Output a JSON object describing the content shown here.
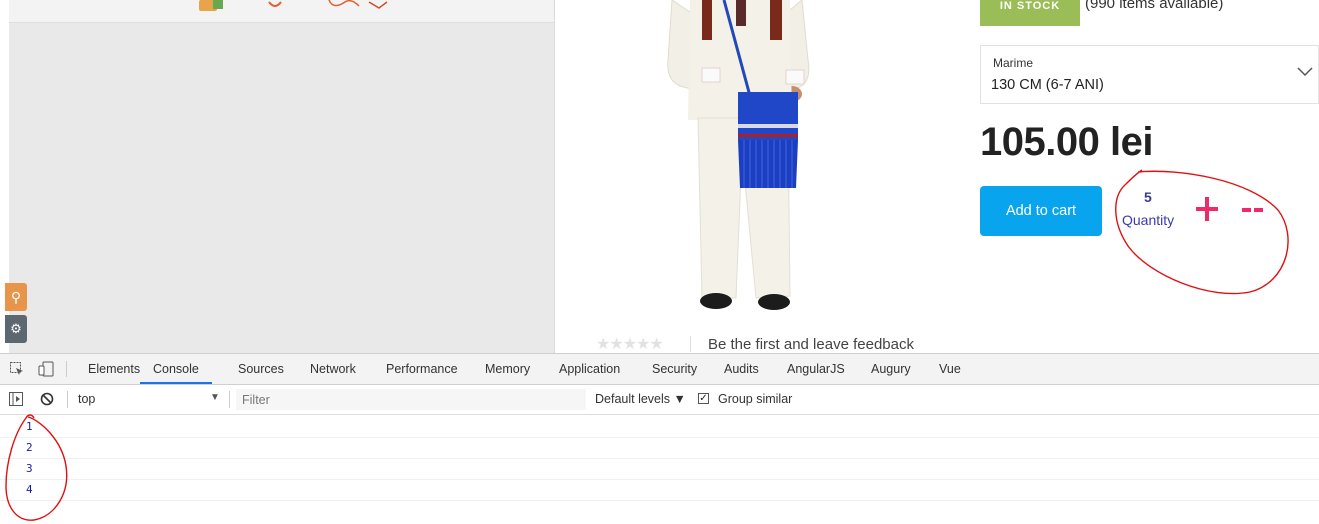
{
  "product": {
    "stock_badge": "IN STOCK",
    "stock_available": "(990 items available)",
    "size_label": "Marime",
    "size_value": "130 CM (6-7 ANI)",
    "price": "105.00 lei",
    "add_to_cart": "Add to cart",
    "quantity_value": "5",
    "quantity_label": "Quantity",
    "rating_stars": "★★★★★",
    "feedback_link": "Be the first and leave feedback"
  },
  "devtools": {
    "tabs": [
      "Elements",
      "Console",
      "Sources",
      "Network",
      "Performance",
      "Memory",
      "Application",
      "Security",
      "Audits",
      "AngularJS",
      "Augury",
      "Vue"
    ],
    "active_tab": "Console",
    "context": "top",
    "filter_placeholder": "Filter",
    "levels": "Default levels ▼",
    "group_similar": "Group similar",
    "group_similar_checked": true,
    "console_lines": [
      "1",
      "2",
      "3",
      "4"
    ]
  },
  "colors": {
    "accent_blue": "#08a4ed",
    "stock_green": "#9bbd57",
    "qty_pink": "#ee2a6b",
    "annotation_red": "#e01010"
  },
  "icons": {
    "widget_top": "cart-icon",
    "widget_bottom": "gear-icon",
    "size_select": "chevron-down-icon"
  }
}
